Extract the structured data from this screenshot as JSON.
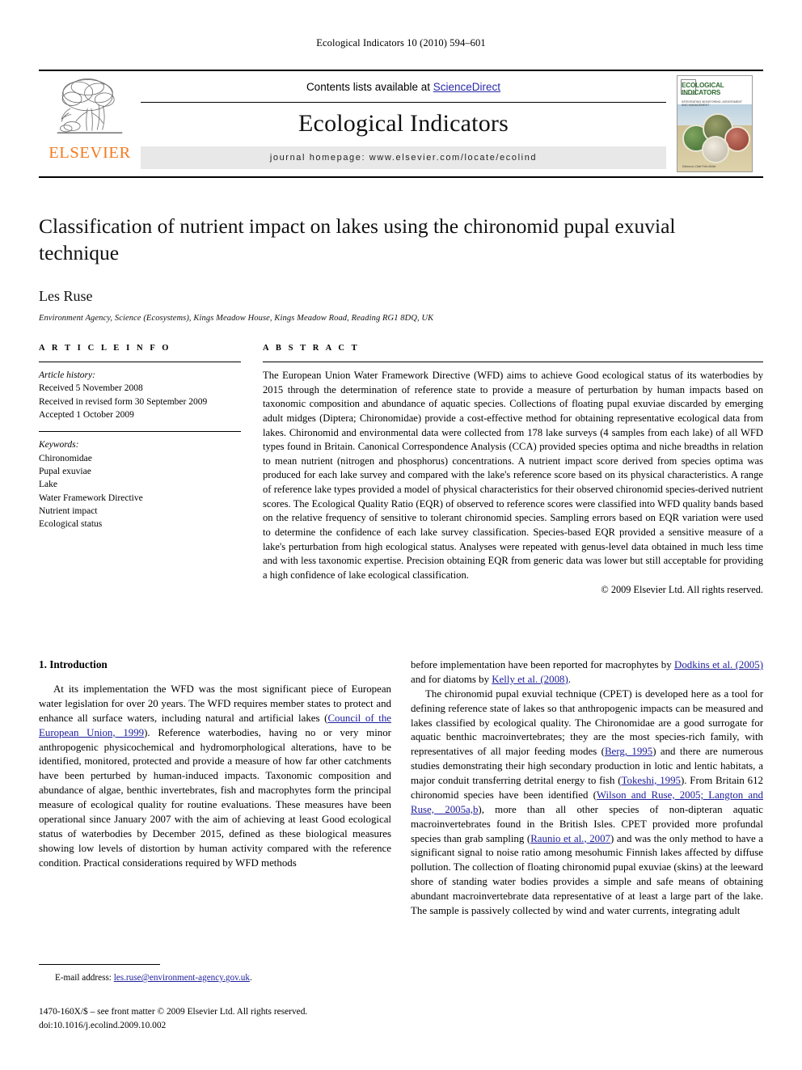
{
  "running_head": "Ecological Indicators 10 (2010) 594–601",
  "masthead": {
    "contents_prefix": "Contents lists available at ",
    "sciencedirect": "ScienceDirect",
    "journal_title": "Ecological Indicators",
    "homepage": "journal homepage: www.elsevier.com/locate/ecolind",
    "publisher": "ELSEVIER",
    "cover": {
      "title": "ECOLOGICAL INDICATORS",
      "subtitle": "INTEGRATING MONITORING, ASSESSMENT AND MANAGEMENT",
      "footer": "Editors-in-Chief\nFelix Müller"
    },
    "accent_link_color": "#2a2aa8",
    "elsevier_orange": "#f47b20"
  },
  "article": {
    "title": "Classification of nutrient impact on lakes using the chironomid pupal exuvial technique",
    "author": "Les Ruse",
    "affiliation": "Environment Agency, Science (Ecosystems), Kings Meadow House, Kings Meadow Road, Reading RG1 8DQ, UK"
  },
  "article_info": {
    "heading": "A R T I C L E  I N F O",
    "history_label": "Article history:",
    "history": [
      "Received 5 November 2008",
      "Received in revised form 30 September 2009",
      "Accepted 1 October 2009"
    ],
    "keywords_label": "Keywords:",
    "keywords": [
      "Chironomidae",
      "Pupal exuviae",
      "Lake",
      "Water Framework Directive",
      "Nutrient impact",
      "Ecological status"
    ]
  },
  "abstract": {
    "heading": "A B S T R A C T",
    "text": "The European Union Water Framework Directive (WFD) aims to achieve Good ecological status of its waterbodies by 2015 through the determination of reference state to provide a measure of perturbation by human impacts based on taxonomic composition and abundance of aquatic species. Collections of floating pupal exuviae discarded by emerging adult midges (Diptera; Chironomidae) provide a cost-effective method for obtaining representative ecological data from lakes. Chironomid and environmental data were collected from 178 lake surveys (4 samples from each lake) of all WFD types found in Britain. Canonical Correspondence Analysis (CCA) provided species optima and niche breadths in relation to mean nutrient (nitrogen and phosphorus) concentrations. A nutrient impact score derived from species optima was produced for each lake survey and compared with the lake's reference score based on its physical characteristics. A range of reference lake types provided a model of physical characteristics for their observed chironomid species-derived nutrient scores. The Ecological Quality Ratio (EQR) of observed to reference scores were classified into WFD quality bands based on the relative frequency of sensitive to tolerant chironomid species. Sampling errors based on EQR variation were used to determine the confidence of each lake survey classification. Species-based EQR provided a sensitive measure of a lake's perturbation from high ecological status. Analyses were repeated with genus-level data obtained in much less time and with less taxonomic expertise. Precision obtaining EQR from generic data was lower but still acceptable for providing a high confidence of lake ecological classification.",
    "copyright": "© 2009 Elsevier Ltd. All rights reserved."
  },
  "body": {
    "section_number_title": "1. Introduction",
    "left_paragraph_1_a": "At its implementation the WFD was the most significant piece of European water legislation for over 20 years. The WFD requires member states to protect and enhance all surface waters, including natural and artificial lakes (",
    "left_cite_1": "Council of the European Union, 1999",
    "left_paragraph_1_b": "). Reference waterbodies, having no or very minor anthropogenic physicochemical and hydromorphological alterations, have to be identified, monitored, protected and provide a measure of how far other catchments have been perturbed by human-induced impacts. Taxonomic composition and abundance of algae, benthic invertebrates, fish and macrophytes form the principal measure of ecological quality for routine evaluations. These measures have been operational since January 2007 with the aim of achieving at least Good ecological status of waterbodies by December 2015, defined as these biological measures showing low levels of distortion by human activity compared with the reference condition. Practical considerations required by WFD methods",
    "right_paragraph_1_a": "before implementation have been reported for macrophytes by ",
    "right_cite_1": "Dodkins et al. (2005)",
    "right_paragraph_1_b": " and for diatoms by ",
    "right_cite_2": "Kelly et al. (2008)",
    "right_paragraph_1_c": ".",
    "right_paragraph_2_a": "The chironomid pupal exuvial technique (CPET) is developed here as a tool for defining reference state of lakes so that anthropogenic impacts can be measured and lakes classified by ecological quality. The Chironomidae are a good surrogate for aquatic benthic macroinvertebrates; they are the most species-rich family, with representatives of all major feeding modes (",
    "right_cite_3": "Berg, 1995",
    "right_paragraph_2_b": ") and there are numerous studies demonstrating their high secondary production in lotic and lentic habitats, a major conduit transferring detrital energy to fish (",
    "right_cite_4": "Tokeshi, 1995",
    "right_paragraph_2_c": "). From Britain 612 chironomid species have been identified (",
    "right_cite_5": "Wilson and Ruse, 2005; Langton and Ruse, 2005a,b",
    "right_paragraph_2_d": "), more than all other species of non-dipteran aquatic macroinvertebrates found in the British Isles. CPET provided more profundal species than grab sampling (",
    "right_cite_6": "Raunio et al., 2007",
    "right_paragraph_2_e": ") and was the only method to have a significant signal to noise ratio among mesohumic Finnish lakes affected by diffuse pollution. The collection of floating chironomid pupal exuviae (skins) at the leeward shore of standing water bodies provides a simple and safe means of obtaining abundant macroinvertebrate data representative of at least a large part of the lake. The sample is passively collected by wind and water currents, integrating adult"
  },
  "footer": {
    "email_label": "E-mail address:",
    "email": "les.ruse@environment-agency.gov.uk",
    "email_suffix": ".",
    "front_matter": "1470-160X/$ – see front matter © 2009 Elsevier Ltd. All rights reserved.",
    "doi": "doi:10.1016/j.ecolind.2009.10.002"
  }
}
